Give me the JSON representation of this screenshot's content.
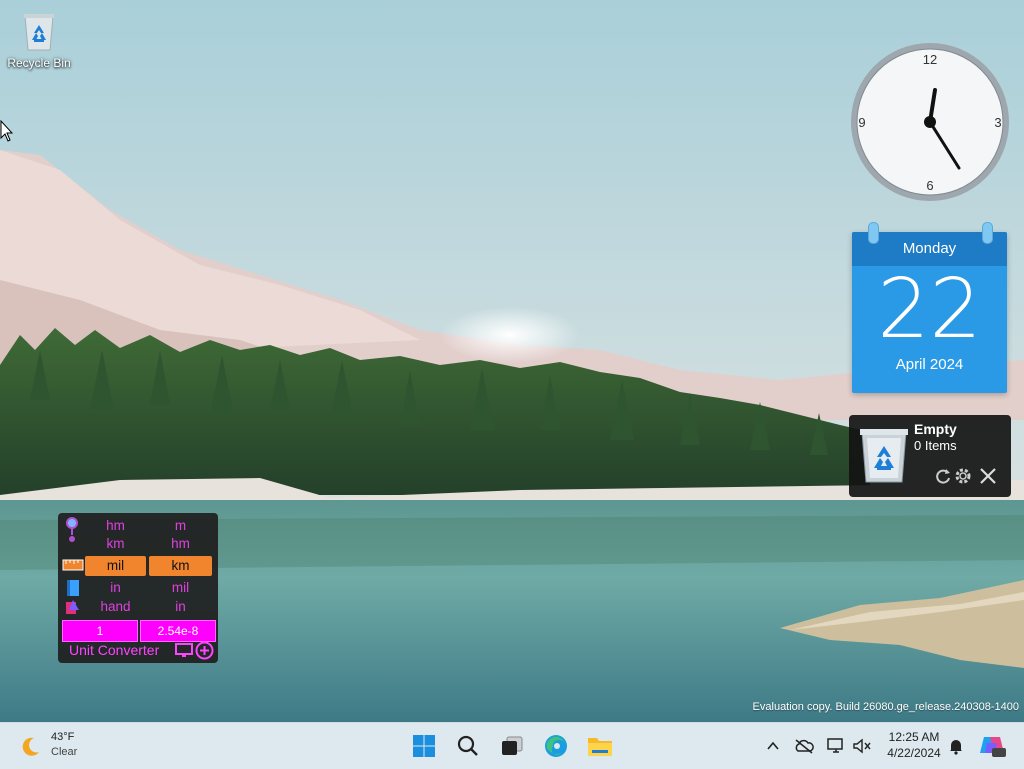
{
  "desktop": {
    "icons": [
      {
        "label": "Recycle Bin",
        "icon": "recycle-bin-icon"
      }
    ],
    "watermark": "Evaluation copy. Build 26080.ge_release.240308-1400"
  },
  "clock_gadget": {
    "numerals": [
      "12",
      "3",
      "6",
      "9"
    ],
    "time_shown": "12:25"
  },
  "calendar_gadget": {
    "weekday": "Monday",
    "day": "22",
    "month_year": "April 2024",
    "accent": "#2b9ae6"
  },
  "recycle_bin_gadget": {
    "title": "Empty",
    "subtitle": "0 Items",
    "controls": [
      "refresh-icon",
      "settings-icon",
      "close-icon"
    ]
  },
  "unit_converter": {
    "rows": [
      {
        "icon": "length-icon",
        "left": "hm",
        "right": "m"
      },
      {
        "icon": "ruler-icon",
        "left": "km",
        "right": "hm"
      },
      {
        "icon": "scale-icon",
        "left": "mil",
        "right": "km",
        "selected": true
      },
      {
        "icon": "book-icon",
        "left": "in",
        "right": "mil"
      },
      {
        "icon": "shapes-icon",
        "left": "hand",
        "right": "in"
      }
    ],
    "input_value": "1",
    "output_value": "2.54e-8",
    "title": "Unit Converter",
    "accent": "#ff00ff",
    "selection_color": "#f0852e"
  },
  "taskbar": {
    "weather": {
      "temp": "43°F",
      "condition": "Clear",
      "icon": "moon-icon"
    },
    "apps": [
      "start-icon",
      "search-icon",
      "task-view-icon",
      "edge-icon",
      "file-explorer-icon"
    ],
    "tray": [
      "chevron-up-icon",
      "onedrive-icon",
      "network-icon",
      "volume-muted-icon",
      "notification-bell-icon",
      "copilot-icon"
    ],
    "time": "12:25 AM",
    "date": "4/22/2024"
  }
}
